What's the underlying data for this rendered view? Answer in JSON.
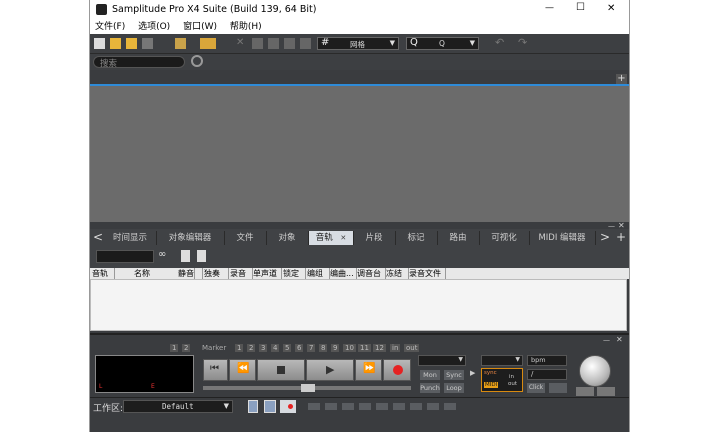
{
  "window": {
    "title": "Samplitude Pro X4 Suite (Build 139, 64 Bit)",
    "minimize": "—",
    "maximize": "☐",
    "close": "✕"
  },
  "menu": {
    "items": [
      "文件(F)",
      "选项(O)",
      "窗口(W)",
      "帮助(H)"
    ]
  },
  "toolbar": {
    "grid_value": "网格",
    "zoom_value": "Q"
  },
  "search": {
    "placeholder": "搜索"
  },
  "tabs": {
    "items": [
      "时间显示",
      "对象编辑器",
      "文件",
      "对象",
      "音轨",
      "片段",
      "标记",
      "路由",
      "可视化",
      "MIDI 编辑器"
    ],
    "active_index": 4,
    "close_glyph": "✕"
  },
  "track_table": {
    "columns": [
      "音轨",
      "名称",
      "静音",
      "独奏",
      "录音",
      "单声道",
      "锁定",
      "编组",
      "编曲...",
      "调音台",
      "冻结",
      "录音文件"
    ]
  },
  "transport": {
    "marker_label": "Marker",
    "marker_numbers": [
      "1",
      "2",
      "3",
      "4",
      "5",
      "6",
      "7",
      "8",
      "9",
      "10",
      "11",
      "12"
    ],
    "left_numbers": [
      "1",
      "2"
    ],
    "in_label": "in",
    "out_label": "out",
    "mon_label": "Mon",
    "sync_label": "Sync",
    "punch_label": "Punch",
    "loop_label": "Loop",
    "bpm_label": "bpm",
    "sync_small": "sync",
    "midi_small": "MIDI",
    "in_small": "in",
    "out_small": "out",
    "click_label": "Click",
    "l_label": "L",
    "e_label": "E",
    "slash": "/"
  },
  "bottom": {
    "workspace_label": "工作区:",
    "workspace_value": "Default"
  },
  "colors": {
    "accent": "#2e8bd8",
    "record": "#e52222",
    "tab_active": "#d8dde3"
  }
}
